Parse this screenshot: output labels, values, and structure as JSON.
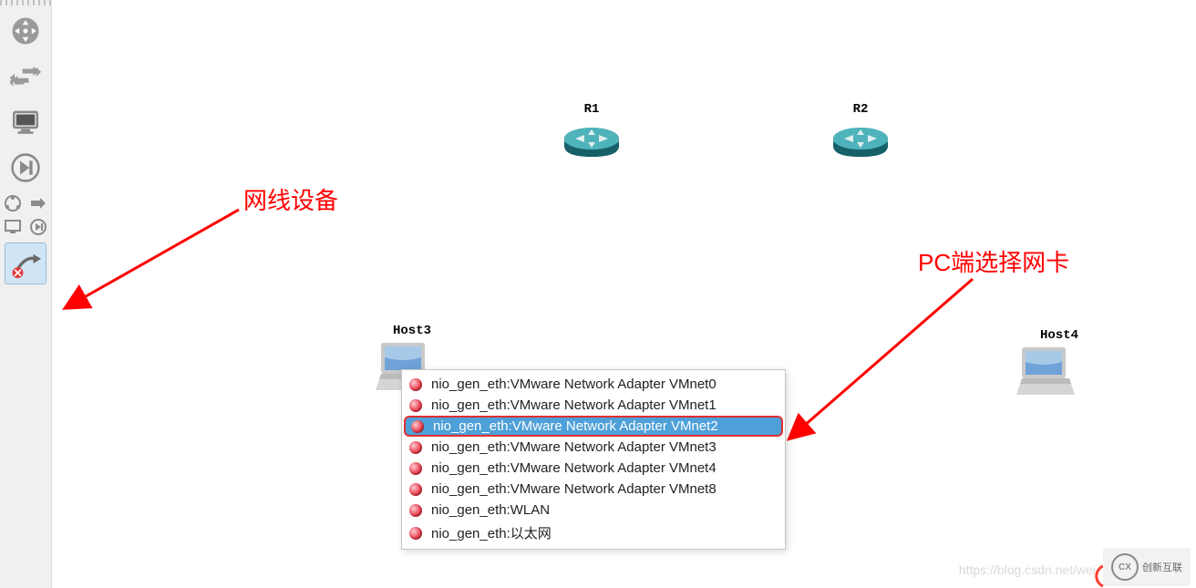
{
  "toolbar": {
    "buttons": [
      {
        "name": "pan-tool-icon"
      },
      {
        "name": "move-arrows-icon"
      },
      {
        "name": "monitor-icon"
      },
      {
        "name": "step-forward-icon"
      }
    ],
    "mini_row1": [
      {
        "name": "topology-icon"
      },
      {
        "name": "arrow-right-icon"
      }
    ],
    "mini_row2": [
      {
        "name": "monitor-small-icon"
      },
      {
        "name": "step-small-icon"
      }
    ],
    "selected_button": {
      "name": "cable-tool-icon"
    }
  },
  "devices": {
    "router1": {
      "label": "R1"
    },
    "router2": {
      "label": "R2"
    },
    "host3": {
      "label": "Host3"
    },
    "host4": {
      "label": "Host4"
    }
  },
  "annotations": {
    "cable_label": "网线设备",
    "nic_label": "PC端选择网卡"
  },
  "dropdown": {
    "items": [
      {
        "label": "nio_gen_eth:VMware Network Adapter VMnet0"
      },
      {
        "label": "nio_gen_eth:VMware Network Adapter VMnet1"
      },
      {
        "label": "nio_gen_eth:VMware Network Adapter VMnet2"
      },
      {
        "label": "nio_gen_eth:VMware Network Adapter VMnet3"
      },
      {
        "label": "nio_gen_eth:VMware Network Adapter VMnet4"
      },
      {
        "label": "nio_gen_eth:VMware Network Adapter VMnet8"
      },
      {
        "label": "nio_gen_eth:WLAN"
      },
      {
        "label": "nio_gen_eth:以太网"
      }
    ],
    "selected_index": 2
  },
  "watermark": "https://blog.csdn.net/wei",
  "logo_text": "创新互联"
}
